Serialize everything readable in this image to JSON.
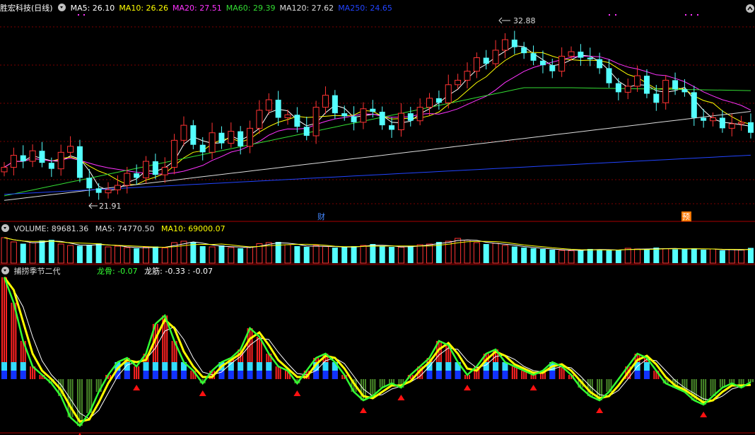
{
  "main": {
    "title": "胜宏科技(日线)",
    "ma_labels": [
      {
        "text": "MA5: 26.10",
        "color": "#ffffff"
      },
      {
        "text": "MA10: 26.26",
        "color": "#ffff00"
      },
      {
        "text": "MA20: 27.51",
        "color": "#ff33ff"
      },
      {
        "text": "MA60: 29.39",
        "color": "#33dd33"
      },
      {
        "text": "MA120: 27.62",
        "color": "#dddddd"
      },
      {
        "text": "MA250: 24.65",
        "color": "#2244ff"
      }
    ],
    "high_label": "32.88",
    "low_label": "21.91",
    "marker_cai": "财",
    "marker_yu": "预"
  },
  "volume": {
    "label": "VOLUME: 89681.36",
    "ma5": "MA5: 74770.50",
    "ma10": "MA10: 69000.07"
  },
  "indicator": {
    "name": "捕捞季节二代",
    "longgu": "龙骨: -0.07",
    "longjin": "龙筋: -0.33 : -0.07"
  },
  "colors": {
    "up": "#ff3333",
    "down": "#54ffff",
    "ma5": "#ffffff",
    "ma10": "#ffff00",
    "ma20": "#ff33ff",
    "ma60": "#33dd33",
    "ma120": "#dddddd",
    "ma250": "#2244ff",
    "grid": "#7a0000"
  },
  "chart_data": [
    {
      "type": "candlestick",
      "title": "胜宏科技(日线)",
      "price_range": [
        21.0,
        34.0
      ],
      "high": 32.88,
      "low": 21.91,
      "close_series": [
        23.8,
        24.6,
        24.2,
        24.9,
        24.1,
        23.7,
        24.8,
        25.2,
        23.1,
        22.4,
        22.1,
        22.3,
        22.6,
        23.4,
        23.1,
        24.2,
        23.3,
        23.8,
        25.6,
        26.6,
        25.3,
        24.8,
        26.1,
        25.4,
        26.2,
        25.2,
        26.4,
        27.6,
        28.3,
        27.1,
        27.3,
        26.5,
        25.9,
        27.8,
        28.6,
        27.4,
        27.2,
        26.8,
        27.7,
        27.5,
        26.6,
        26.3,
        27.4,
        26.9,
        27.8,
        28.4,
        28.1,
        29.3,
        29.6,
        30.2,
        31.1,
        30.7,
        31.6,
        32.3,
        31.8,
        31.4,
        30.9,
        30.6,
        30.2,
        31.2,
        31.5,
        31.1,
        31.0,
        30.4,
        29.4,
        28.8,
        29.2,
        29.9,
        28.7,
        28.1,
        29.6,
        29.0,
        28.8,
        27.1,
        26.9,
        27.1,
        26.4,
        26.7,
        26.8,
        26.1
      ],
      "series": [
        {
          "name": "MA5",
          "last": 26.1
        },
        {
          "name": "MA10",
          "last": 26.26
        },
        {
          "name": "MA20",
          "last": 27.51
        },
        {
          "name": "MA60",
          "last": 29.39
        },
        {
          "name": "MA120",
          "last": 27.62
        },
        {
          "name": "MA250",
          "last": 24.65
        }
      ]
    },
    {
      "type": "bar",
      "title": "VOLUME",
      "last": 89681.36,
      "ma5": 74770.5,
      "ma10": 69000.07,
      "values": [
        72,
        60,
        55,
        58,
        64,
        66,
        54,
        50,
        49,
        52,
        56,
        46,
        48,
        44,
        42,
        45,
        47,
        43,
        58,
        62,
        60,
        48,
        46,
        50,
        44,
        42,
        46,
        55,
        58,
        60,
        52,
        48,
        46,
        50,
        47,
        44,
        45,
        48,
        50,
        54,
        47,
        46,
        45,
        48,
        52,
        54,
        60,
        62,
        70,
        65,
        58,
        54,
        56,
        50,
        47,
        44,
        42,
        40,
        38,
        36,
        35,
        37,
        40,
        38,
        36,
        37,
        42,
        40,
        38,
        44,
        41,
        39,
        40,
        42,
        38,
        40,
        36,
        38,
        37,
        43
      ]
    },
    {
      "type": "bar",
      "title": "捕捞季节二代",
      "series": [
        {
          "name": "龙骨",
          "last": -0.07
        },
        {
          "name": "龙筋",
          "last": -0.33
        }
      ],
      "values": [
        2.4,
        1.8,
        0.9,
        0.3,
        0.1,
        -0.1,
        -0.4,
        -0.9,
        -1.1,
        -0.8,
        -0.3,
        0.1,
        0.4,
        0.5,
        0.3,
        0.6,
        1.3,
        1.5,
        0.9,
        0.4,
        0.2,
        -0.1,
        0.2,
        0.4,
        0.5,
        0.7,
        1.2,
        1.0,
        0.6,
        0.3,
        0.2,
        -0.1,
        0.2,
        0.5,
        0.6,
        0.4,
        0.1,
        -0.3,
        -0.5,
        -0.4,
        -0.2,
        -0.1,
        -0.2,
        0.1,
        0.3,
        0.5,
        0.9,
        0.8,
        0.4,
        0.1,
        0.3,
        0.6,
        0.7,
        0.4,
        0.3,
        0.2,
        0.1,
        0.2,
        0.4,
        0.3,
        0.1,
        -0.2,
        -0.4,
        -0.5,
        -0.3,
        0.0,
        0.3,
        0.6,
        0.5,
        0.2,
        -0.1,
        -0.2,
        -0.3,
        -0.5,
        -0.6,
        -0.4,
        -0.2,
        -0.1,
        -0.2,
        -0.07
      ]
    }
  ]
}
